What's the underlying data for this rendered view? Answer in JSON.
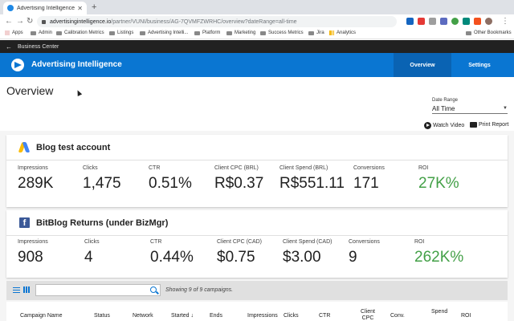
{
  "browser": {
    "tab_title": "Advertising Intelligence",
    "url_host": "advertisingintelligence.io",
    "url_path": "/partner/VUNI/business/AG-7QVMFZWRHC/overview?dateRange=all-time",
    "bookmarks": [
      "Apps",
      "Admin",
      "Calibration Metrics",
      "Listings",
      "Advertising Intelli...",
      "Platform",
      "Marketing",
      "Success Metrics",
      "Jira",
      "Analytics"
    ],
    "other_bookmarks": "Other Bookmarks"
  },
  "business_center": {
    "label": "Business Center"
  },
  "app": {
    "title": "Advertising Intelligence",
    "nav": [
      "Overview",
      "Settings"
    ],
    "accent": "#0a76d2"
  },
  "page": {
    "title": "Overview",
    "date_range_label": "Date Range",
    "date_range_value": "All Time",
    "watch_video": "Watch Video",
    "print_report": "Print Report"
  },
  "accounts": [
    {
      "name": "Blog test account",
      "platform_icon": "google-ads-icon",
      "metrics": [
        {
          "label": "Impressions",
          "value": "289K"
        },
        {
          "label": "Clicks",
          "value": "1,475"
        },
        {
          "label": "CTR",
          "value": "0.51%"
        },
        {
          "label": "Client CPC (BRL)",
          "value": "R$0.37"
        },
        {
          "label": "Client Spend (BRL)",
          "value": "R$551.11"
        },
        {
          "label": "Conversions",
          "value": "171"
        },
        {
          "label": "ROI",
          "value": "27K%"
        }
      ]
    },
    {
      "name": "BitBlog Returns (under BizMgr)",
      "platform_icon": "facebook-icon",
      "metrics": [
        {
          "label": "Impressions",
          "value": "908"
        },
        {
          "label": "Clicks",
          "value": "4"
        },
        {
          "label": "CTR",
          "value": "0.44%"
        },
        {
          "label": "Client CPC (CAD)",
          "value": "$0.75"
        },
        {
          "label": "Client Spend (CAD)",
          "value": "$3.00"
        },
        {
          "label": "Conversions",
          "value": "9"
        },
        {
          "label": "ROI",
          "value": "262K%"
        }
      ]
    }
  ],
  "campaigns": {
    "showing_text": "Showing 9 of 9 campaigns.",
    "search_placeholder": "",
    "columns": [
      "Campaign Name",
      "Status",
      "Network",
      "Started ↓",
      "Ends",
      "Impressions",
      "Clicks",
      "CTR",
      "Client CPC",
      "Conv.",
      "Spend",
      "ROI"
    ]
  },
  "colors": {
    "roi_green": "#43a047",
    "header_dark": "#212121"
  }
}
